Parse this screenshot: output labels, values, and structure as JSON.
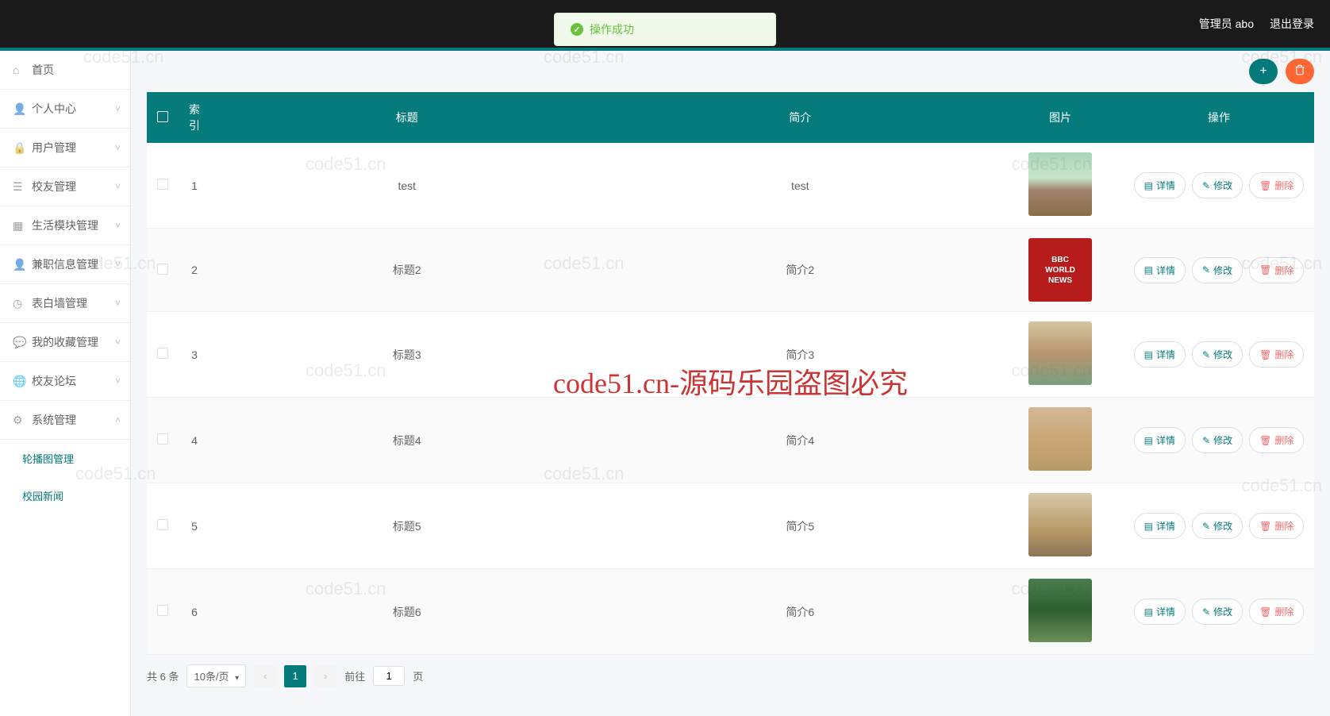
{
  "header": {
    "admin_label": "管理员 abo",
    "logout_label": "退出登录"
  },
  "toast": {
    "text": "操作成功"
  },
  "sidebar": {
    "items": [
      {
        "icon": "home",
        "label": "首页",
        "has_sub": false
      },
      {
        "icon": "user",
        "label": "个人中心",
        "has_sub": true
      },
      {
        "icon": "lock",
        "label": "用户管理",
        "has_sub": true
      },
      {
        "icon": "list",
        "label": "校友管理",
        "has_sub": true
      },
      {
        "icon": "grid",
        "label": "生活模块管理",
        "has_sub": true
      },
      {
        "icon": "user",
        "label": "兼职信息管理",
        "has_sub": true
      },
      {
        "icon": "clock",
        "label": "表白墙管理",
        "has_sub": true
      },
      {
        "icon": "chat",
        "label": "我的收藏管理",
        "has_sub": true
      },
      {
        "icon": "globe",
        "label": "校友论坛",
        "has_sub": true
      },
      {
        "icon": "gear",
        "label": "系统管理",
        "has_sub": true,
        "expanded": true
      }
    ],
    "submenu": [
      {
        "label": "轮播图管理"
      },
      {
        "label": "校园新闻"
      }
    ]
  },
  "table": {
    "headers": {
      "index": "索引",
      "title": "标题",
      "intro": "简介",
      "image": "图片",
      "op": "操作"
    },
    "rows": [
      {
        "idx": "1",
        "title": "test",
        "intro": "test",
        "thumb": "t1"
      },
      {
        "idx": "2",
        "title": "标题2",
        "intro": "简介2",
        "thumb": "t2"
      },
      {
        "idx": "3",
        "title": "标题3",
        "intro": "简介3",
        "thumb": "t3"
      },
      {
        "idx": "4",
        "title": "标题4",
        "intro": "简介4",
        "thumb": "t4"
      },
      {
        "idx": "5",
        "title": "标题5",
        "intro": "简介5",
        "thumb": "t5"
      },
      {
        "idx": "6",
        "title": "标题6",
        "intro": "简介6",
        "thumb": "t6"
      }
    ],
    "actions": {
      "detail": "详情",
      "edit": "修改",
      "delete": "删除"
    }
  },
  "pagination": {
    "total_text": "共 6 条",
    "page_size": "10条/页",
    "current": "1",
    "goto_label": "前往",
    "page_suffix": "页",
    "goto_value": "1"
  },
  "watermark": {
    "small": "code51.cn",
    "big": "code51.cn-源码乐园盗图必究"
  },
  "bbc": {
    "l1": "BBC",
    "l2": "WORLD",
    "l3": "NEWS"
  }
}
